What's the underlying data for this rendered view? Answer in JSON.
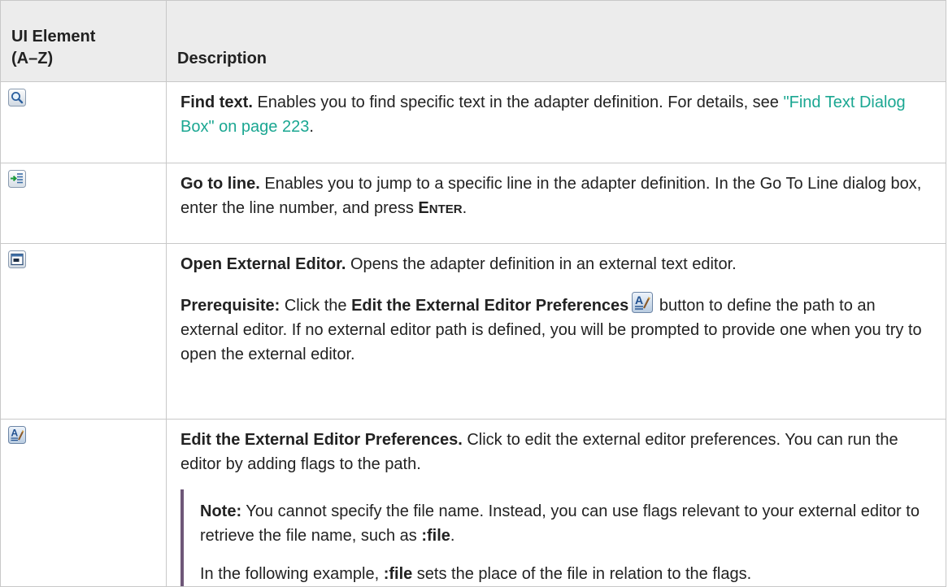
{
  "table": {
    "header": {
      "col1_line1": "UI Element",
      "col1_line2": "(A–Z)",
      "col2": "Description"
    },
    "rows": [
      {
        "icon": "search-icon",
        "title": "Find text.",
        "text": " Enables you to find specific text in the adapter definition. For details, see ",
        "link": "\"Find Text Dialog Box\" on page 223",
        "after_link": "."
      },
      {
        "icon": "go-to-line-icon",
        "title": "Go to line.",
        "text": " Enables you to jump to a specific line in the adapter definition. In the Go To Line dialog box, enter the line number, and press ",
        "key_first": "E",
        "key_rest": "NTER",
        "after_key": "."
      },
      {
        "icon": "external-editor-window-icon",
        "title": "Open External Editor.",
        "text": " Opens the adapter definition in an external text editor.",
        "prereq_label": "Prerequisite:",
        "prereq_text1": " Click the ",
        "prereq_bold": "Edit the External Editor Preferences",
        "prereq_text2": " button to define the path to an external editor. If no external editor path is defined, you will be prompted to provide one when you try to open the external editor."
      },
      {
        "icon": "edit-preferences-icon",
        "title": "Edit the External Editor Preferences.",
        "text": " Click to edit the external editor preferences. You can run the editor by adding flags to the path.",
        "note_label": "Note:",
        "note_text": "  You cannot specify the file name. Instead, you can use flags relevant to your external editor to retrieve the file name, such as ",
        "note_code": ":file",
        "note_end": ".",
        "example_text1": "In the following example, ",
        "example_code": ":file",
        "example_text2": " sets the place of the file in relation to the flags."
      }
    ]
  },
  "colors": {
    "header_bg": "#ececec",
    "border": "#c8c8c8",
    "link": "#1ba792",
    "note_bar": "#6e5778"
  }
}
